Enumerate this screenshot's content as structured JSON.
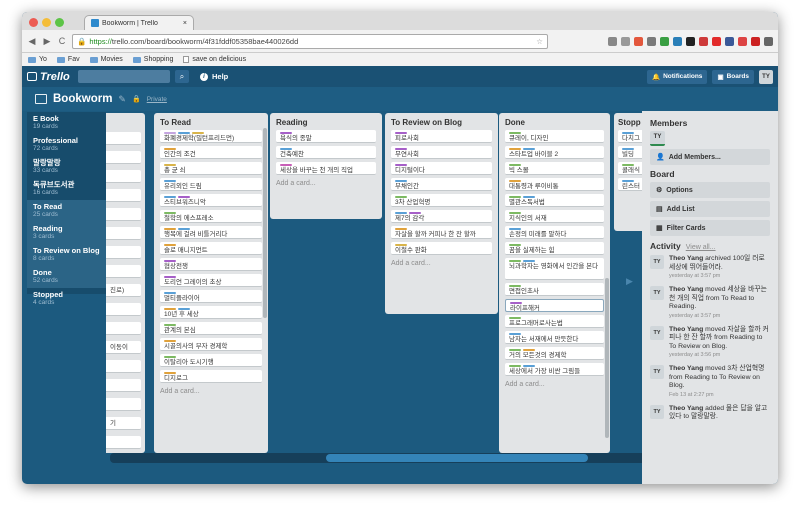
{
  "browser": {
    "tab_title": "Bookworm | Trello",
    "url_scheme": "https://",
    "url_rest": "trello.com/board/bookworm/4f31fddf05358bae440026dd",
    "nav": {
      "back": "◀",
      "forward": "▶",
      "reload": "C"
    },
    "bookmarks": [
      "Yo",
      "Fav",
      "Movies",
      "Shopping",
      "save on delicious"
    ],
    "extension_colors": [
      "#888888",
      "#999999",
      "#e3573c",
      "#7a7a7a",
      "#3a9f43",
      "#2a7fb8",
      "#222222",
      "#ce3a3a",
      "#e22b2b",
      "#3b5998",
      "#dd4444",
      "#cc2222",
      "#666666"
    ]
  },
  "header": {
    "logo": "Trello",
    "help": "Help",
    "notifications": "Notifications",
    "boards": "Boards",
    "avatar": "TY"
  },
  "board": {
    "title": "Bookworm",
    "privacy": "Private"
  },
  "left_panel": [
    {
      "name": "E Book",
      "count": "19 cards"
    },
    {
      "name": "Professional",
      "count": "72 cards"
    },
    {
      "name": "말랑말랑",
      "count": "33 cards"
    },
    {
      "name": "독큐브도서관",
      "count": "16 cards"
    },
    {
      "name": "To Read",
      "count": "25 cards",
      "active": true
    },
    {
      "name": "Reading",
      "count": "3 cards",
      "active": true
    },
    {
      "name": "To Review on Blog",
      "count": "8 cards",
      "active": true
    },
    {
      "name": "Done",
      "count": "52 cards",
      "active": true
    },
    {
      "name": "Stopped",
      "count": "4 cards"
    }
  ],
  "lists": {
    "partial": {
      "title": "",
      "cards": [
        {
          "text": ""
        },
        {
          "text": ""
        },
        {
          "text": ""
        },
        {
          "text": ""
        },
        {
          "text": ""
        },
        {
          "text": ""
        },
        {
          "text": ""
        },
        {
          "text": ""
        },
        {
          "text": "진로)"
        },
        {
          "text": ""
        },
        {
          "text": ""
        },
        {
          "text": "이동이"
        },
        {
          "text": ""
        },
        {
          "text": ""
        },
        {
          "text": ""
        },
        {
          "text": "기"
        },
        {
          "text": ""
        }
      ]
    },
    "to_read": {
      "title": "To Read",
      "add": "Add a card...",
      "cards": [
        {
          "text": "화폐경제학(밀턴프리드먼)",
          "labels": [
            "#c5a5e0",
            "#5aa0d6",
            "#d9b44a"
          ]
        },
        {
          "text": "인간의 조건",
          "labels": [
            "#e0a23c"
          ]
        },
        {
          "text": "총 균 쇠",
          "labels": [
            "#d9b44a"
          ]
        },
        {
          "text": "유리외인 드림",
          "labels": [
            "#5aa0d6"
          ]
        },
        {
          "text": "스티브워즈니악",
          "labels": [
            "#5aa0d6",
            "#a65fc8"
          ]
        },
        {
          "text": "철학의 에스프레소",
          "labels": [
            "#7dba63"
          ]
        },
        {
          "text": "행복에 걸려 비틀거리다",
          "labels": [
            "#e0a23c",
            "#5aa0d6"
          ]
        },
        {
          "text": "슬로 매니지먼트",
          "labels": [
            "#e0a23c"
          ]
        },
        {
          "text": "협상전쟁",
          "labels": [
            "#a65fc8"
          ]
        },
        {
          "text": "도리언 그레이의 초상",
          "labels": [
            "#a65fc8"
          ]
        },
        {
          "text": "멀티플라이어",
          "labels": [
            "#5aa0d6"
          ]
        },
        {
          "text": "10년 후 세상",
          "labels": [
            "#e0a23c",
            "#5aa0d6"
          ]
        },
        {
          "text": "관계의 본심",
          "labels": [
            "#7dba63"
          ]
        },
        {
          "text": "시골의사의 부자 경제학",
          "labels": [
            "#e0a23c"
          ]
        },
        {
          "text": "이탈리아 도시기행",
          "labels": [
            "#7dba63"
          ]
        },
        {
          "text": "디지로그",
          "labels": [
            "#e0a23c"
          ]
        }
      ]
    },
    "reading": {
      "title": "Reading",
      "add": "Add a card...",
      "cards": [
        {
          "text": "욕식의 종말",
          "labels": [
            "#a65fc8"
          ]
        },
        {
          "text": "건축예찬",
          "labels": [
            "#5aa0d6"
          ]
        },
        {
          "text": "세상을 바꾸는 천 개의 직업",
          "labels": [
            "#c85fb8"
          ]
        }
      ]
    },
    "to_review": {
      "title": "To Review on Blog",
      "add": "Add a card...",
      "cards": [
        {
          "text": "피로사회",
          "labels": [
            "#a65fc8"
          ]
        },
        {
          "text": "무연사회",
          "labels": [
            "#a65fc8"
          ]
        },
        {
          "text": "디지털이다",
          "labels": [
            "#a65fc8"
          ]
        },
        {
          "text": "부채인간",
          "labels": [
            "#5aa0d6"
          ]
        },
        {
          "text": "3차 산업혁명",
          "labels": [
            "#7dba63"
          ]
        },
        {
          "text": "제7의 감각",
          "labels": [
            "#5aa0d6",
            "#a65fc8"
          ]
        },
        {
          "text": "자살을 할까 커피나 한 잔 할까",
          "labels": [
            "#e0a23c"
          ]
        },
        {
          "text": "이철수 판화",
          "labels": [
            "#d9b44a"
          ]
        }
      ]
    },
    "done": {
      "title": "Done",
      "add": "Add a card...",
      "cards": [
        {
          "text": "큐레이, 디자인",
          "labels": [
            "#7dba63"
          ]
        },
        {
          "text": "스타트업 바이블 2",
          "labels": [
            "#e0a23c",
            "#5aa0d6"
          ]
        },
        {
          "text": "빅 스몰",
          "labels": [
            "#7dba63"
          ]
        },
        {
          "text": "대통령과 루이비통",
          "labels": [
            "#e0a23c"
          ]
        },
        {
          "text": "별관스독서법",
          "labels": [
            "#7dba63",
            "#5aa0d6"
          ]
        },
        {
          "text": "지식인의 서재",
          "labels": [
            "#7dba63"
          ]
        },
        {
          "text": "손정의 미래를 말하다",
          "labels": [
            "#5aa0d6"
          ]
        },
        {
          "text": "꿈을 실제하는 힘",
          "labels": [
            "#7dba63"
          ]
        },
        {
          "text": "뇌과학자는 영화에서 인간을 본다",
          "labels": [
            "#7dba63",
            "#5aa0d6"
          ],
          "tall": true
        },
        {
          "text": "면접인초사",
          "labels": [
            "#7dba63"
          ]
        },
        {
          "text": "라이프해커",
          "labels": [
            "#a65fc8"
          ],
          "selected": true
        },
        {
          "text": "프로그래머로사는법",
          "labels": [
            "#7dba63"
          ]
        },
        {
          "text": "남자는 서재에서 만듯한다",
          "labels": [
            "#5aa0d6"
          ]
        },
        {
          "text": "거의 모든것의 경제학",
          "labels": [
            "#7dba63",
            "#e0a23c"
          ]
        },
        {
          "text": "세상에서 가장 비싼 그림들",
          "labels": [
            "#7dba63",
            "#5aa0d6"
          ]
        }
      ]
    },
    "stopped": {
      "title": "Stopp",
      "cards": [
        {
          "text": "다치그",
          "labels": [
            "#5aa0d6"
          ]
        },
        {
          "text": "빌딩",
          "labels": [
            "#5aa0d6"
          ]
        },
        {
          "text": "콜래식",
          "labels": [
            "#7dba63"
          ]
        },
        {
          "text": "린스터",
          "labels": [
            "#5aa0d6"
          ]
        }
      ]
    }
  },
  "sidebar": {
    "members_title": "Members",
    "member_avatar": "TY",
    "add_members": "Add Members...",
    "board_title": "Board",
    "options": "Options",
    "add_list": "Add List",
    "filter_cards": "Filter Cards",
    "activity_title": "Activity",
    "view_all": "View all...",
    "activities": [
      {
        "user": "Theo Yang",
        "action": "archived 100일 러로 세상에 뛰어들어라.",
        "time": "yesterday at 3:57 pm"
      },
      {
        "user": "Theo Yang",
        "action": "moved 세상을 바꾸는 천 개의 직업 from To Read to Reading.",
        "time": "yesterday at 3:57 pm"
      },
      {
        "user": "Theo Yang",
        "action": "moved 자살을 할까 커피나 한 잔 할까 from Reading to To Review on Blog.",
        "time": "yesterday at 3:56 pm"
      },
      {
        "user": "Theo Yang",
        "action": "moved 3차 산업혁명 from Reading to To Review on Blog.",
        "time": "Feb 13 at 2:27 pm"
      },
      {
        "user": "Theo Yang",
        "action": "added 물은 답을 알고 있다 to 말랑말랑.",
        "time": ""
      }
    ]
  }
}
